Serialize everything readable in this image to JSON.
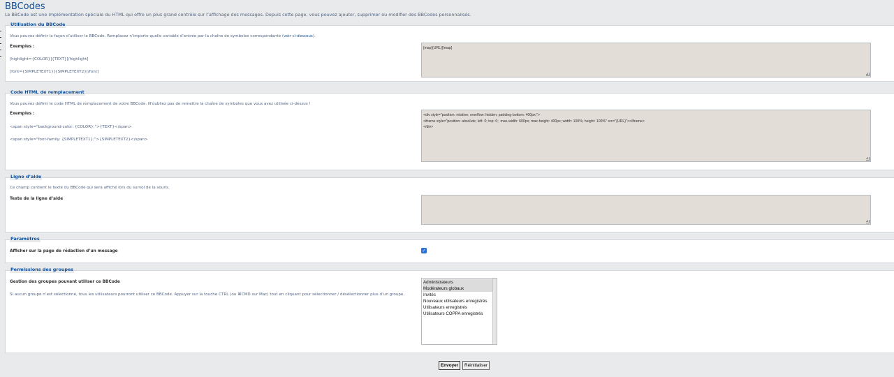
{
  "page": {
    "title": "BBCodes",
    "intro": "Le BBCode est une implémentation spéciale du HTML qui offre un plus grand contrôle sur l’affichage des messages. Depuis cette page, vous pouvez ajouter, supprimer ou modifier des BBCodes personnalisés."
  },
  "usage": {
    "legend": "Utilisation du BBCode",
    "desc": "Vous pouvez définir la façon d’utiliser le BBCode. Remplacez n’importe quelle variable d’entrée par la chaîne de symboles correspondante (",
    "desc_link": "voir ci-dessous",
    "desc_end": ").",
    "examples_label": "Exemples :",
    "example_1": "[highlight={COLOR}]{TEXT}[/highlight]",
    "example_2": "[font={SIMPLETEXT1}]{SIMPLETEXT2}[/font]",
    "value": "[map]{URL}[/map]"
  },
  "html": {
    "legend": "Code HTML de remplacement",
    "desc": "Vous pouvez définir le code HTML de remplacement de votre BBCode. N’oubliez pas de remettre la chaîne de symboles que vous avez utilisée ci-dessus !",
    "examples_label": "Exemples :",
    "example_1": "<span style=\"background-color: {COLOR};\">{TEXT}</span>",
    "example_2": "<span style=\"font-family: {SIMPLETEXT1};\">{SIMPLETEXT2}</span>",
    "value": "<div style=\"position: relative; overflow: hidden; padding-bottom: 400px;\">\n<iframe style=\"position: absolute; left: 0; top: 0;  max-width: 600px; max-height: 400px; width: 100%; height: 100%\" src=\"{URL}\"></iframe>\n</div>"
  },
  "help": {
    "legend": "Ligne d’aide",
    "desc": "Ce champ contient le texte du BBCode qui sera affiché lors du survol de la souris.",
    "label": "Texte de la ligne d’aide",
    "value": ""
  },
  "params": {
    "legend": "Paramètres",
    "display_label": "Afficher sur la page de rédaction d’un message",
    "display_checked": true
  },
  "perms": {
    "legend": "Permissions des groupes",
    "label": "Gestion des groupes pouvant utiliser ce BBCode",
    "desc": "Si aucun groupe n’est sélectionné, tous les utilisateurs pourront utiliser ce BBCode. Appuyer sur la touche CTRL (ou ⌘CMD sur Mac) tout en cliquant pour sélectionner / désélectionner plus d’un groupe.",
    "groups": [
      "Administrateurs",
      "Modérateurs globaux",
      "Invités",
      "Nouveaux utilisateurs enregistrés",
      "Utilisateurs enregistrés",
      "Utilisateurs COPPA enregistrés"
    ]
  },
  "buttons": {
    "submit": "Envoyer",
    "reset": "Réinitialiser"
  },
  "colors": {
    "accent": "#115098",
    "panel_bg": "#ffffff",
    "page_bg": "#e9eaec",
    "textarea_bg": "#e2ddd7",
    "checkbox": "#2d6fd3"
  }
}
